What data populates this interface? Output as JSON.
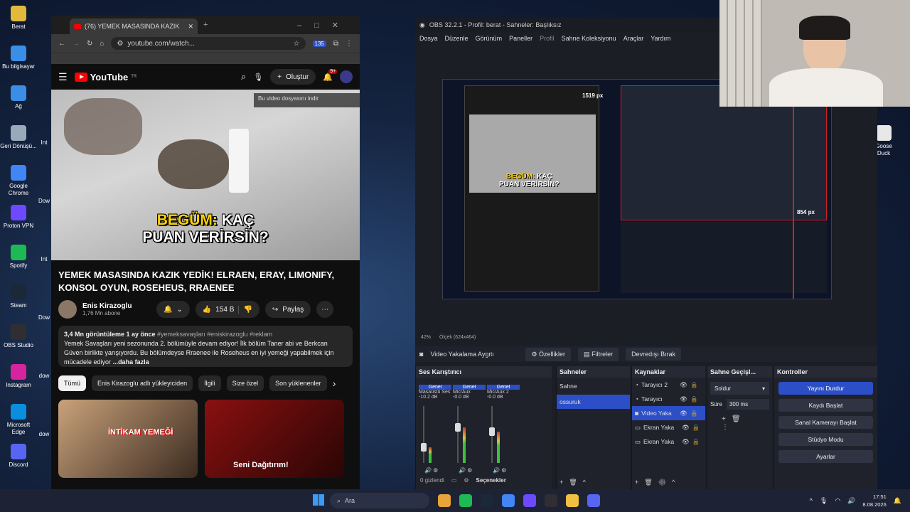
{
  "desktop_icons": [
    {
      "label": "Berat",
      "color": "#e2b93b"
    },
    {
      "label": "Bu bilgisayar",
      "color": "#3a8ee6"
    },
    {
      "label": "Ağ",
      "color": "#3a8ee6"
    },
    {
      "label": "Geri Dönüşü...",
      "color": "#9ab"
    },
    {
      "label": "Google Chrome",
      "color": "#4285f4"
    },
    {
      "label": "Proton VPN",
      "color": "#6d4aff"
    },
    {
      "label": "Spotify",
      "color": "#1db954"
    },
    {
      "label": "Steam",
      "color": "#1b2838"
    },
    {
      "label": "OBS Studio",
      "color": "#302e31"
    },
    {
      "label": "Instagram",
      "color": "#d6249f"
    },
    {
      "label": "Microsoft Edge",
      "color": "#0c8ede"
    },
    {
      "label": "Discord",
      "color": "#5865f2"
    }
  ],
  "desktop_icons_col2": [
    "Int",
    "Dow",
    "Int",
    "Dow",
    "dow",
    "dow"
  ],
  "right_desktop_icon": "Goose Duck",
  "chrome": {
    "tab_title": "(76) YEMEK MASASINDA KAZIK",
    "url": "youtube.com/watch...",
    "badge_count": "135",
    "youtube": {
      "logo_text": "YouTube",
      "region": "TR",
      "create_label": "Oluştur",
      "notif_count": "9+",
      "download_tip": "Bu video dosyasını indir",
      "caption_highlight": "BEGÜM:",
      "caption_line1_rest": " KAÇ",
      "caption_line2": "PUAN VERİRSİN?",
      "title": "YEMEK MASASINDA KAZIK YEDİK! ELRAEN, ERAY, LIMONIFY, KONSOL OYUN, ROSEHEUS, RRAENEE",
      "channel_name": "Enis Kirazoglu",
      "subscribers": "1,76 Mn abone",
      "likes": "154 B",
      "share_label": "Paylaş",
      "views_line": "3,4 Mn görüntüleme  1 ay önce",
      "hashtags": "#yemeksavaşları #eniskirazoglu #reklam",
      "description": "Yemek Savaşları yeni sezonunda 2. bölümüyle devam ediyor! İlk bölüm Taner abi ve Berkcan Güven birlikte yarışıyordu. Bu bölümdeyse Rraenee ile Roseheus en iyi yemeği yapabilmek için mücadele ediyor",
      "more_label": "...daha fazla",
      "chips": [
        "Tümü",
        "Enis Kirazoglu adlı yükleyiciden",
        "İlgili",
        "Size özel",
        "Son yüklenenler"
      ],
      "thumb1_text": "İNTİKAM YEMEĞİ",
      "thumb2_text": "Seni Dağıtırım!"
    }
  },
  "obs": {
    "title": "OBS 32.2.1 - Profil: berat - Sahneler: Başlıksız",
    "menu": [
      "Dosya",
      "Düzenle",
      "Görünüm",
      "Paneller",
      "Profil",
      "Sahne Koleksiyonu",
      "Araçlar",
      "Yardım"
    ],
    "preview_px_top": "1519 px",
    "preview_px_right": "854 px",
    "zoom": "42%",
    "scale": "Ölçek (624x464)",
    "source_bar": {
      "selected_source": "Video Yakalama Aygıtı",
      "properties": "Özellikler",
      "filters": "Filtreler",
      "deactivate": "Devredışı Bırak"
    },
    "mixer": {
      "header": "Ses Karıştırıcı",
      "channels": [
        {
          "tag": "Genel",
          "name": "Masaüstü Ses",
          "db": "-10.2 dB",
          "level": 0.28
        },
        {
          "tag": "Genel",
          "name": "Mic/Aux",
          "db": "-0.0 dB",
          "level": 0.62
        },
        {
          "tag": "Genel",
          "name": "Mic/Aux 2",
          "db": "-0.0 dB",
          "level": 0.55
        }
      ],
      "scale_marks": [
        "0",
        "-6",
        "-12",
        "-18",
        "-24",
        "-30",
        "-36",
        "-42",
        "-48",
        "-54",
        "-60"
      ],
      "hidden_count": "0 gizlendi"
    },
    "scenes": {
      "header": "Sahneler",
      "items": [
        "Sahne",
        "ossuruk"
      ],
      "selected": 1
    },
    "sources": {
      "header": "Kaynaklar",
      "items": [
        {
          "icon": "browser-icon",
          "label": "Tarayıcı 2"
        },
        {
          "icon": "browser-icon",
          "label": "Tarayıcı"
        },
        {
          "icon": "camera-icon",
          "label": "Video Yaka"
        },
        {
          "icon": "monitor-icon",
          "label": "Ekran Yaka"
        },
        {
          "icon": "monitor-icon",
          "label": "Ekran Yaka"
        }
      ],
      "selected": 2
    },
    "transitions": {
      "header": "Sahne Geçişl...",
      "type": "Soldur",
      "duration_label": "Süre",
      "duration_value": "300 ms"
    },
    "controls": {
      "header": "Kontroller",
      "stop_stream": "Yayını Durdur",
      "start_recording": "Kaydı Başlat",
      "virtual_camera": "Sanal Kamerayı Başlat",
      "studio_mode": "Stüdyo Modu",
      "settings": "Ayarlar"
    },
    "options_label": "Seçenekler"
  },
  "taskbar": {
    "search_placeholder": "Ara",
    "time": "17:51",
    "date": "8.08.2026"
  },
  "colors": {
    "youtube_red": "#ff0000",
    "obs_accent": "#2c4fc7",
    "caption_yellow": "#ffd400"
  }
}
